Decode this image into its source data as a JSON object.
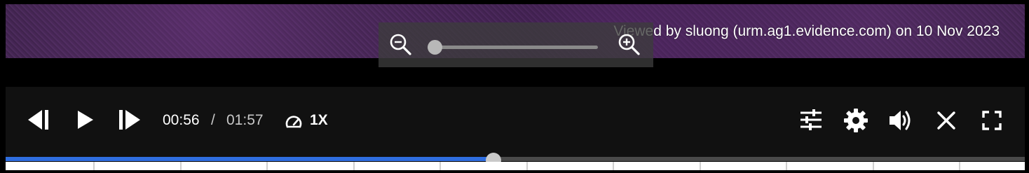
{
  "watermark": {
    "text": "Viewed by sluong (urm.ag1.evidence.com) on 10 Nov 2023"
  },
  "zoom": {
    "level": 0.0,
    "zoom_out_icon": "zoom-out-icon",
    "zoom_in_icon": "zoom-in-icon"
  },
  "player": {
    "current_time": "00:56",
    "separator": "/",
    "duration": "01:57",
    "speed": "1X",
    "progress_fraction": 0.479,
    "icons": {
      "previous_frame": "step-back-icon",
      "play": "play-icon",
      "next_frame": "step-forward-icon",
      "speed": "speedometer-icon",
      "adjust": "sliders-icon",
      "settings": "gear-icon",
      "volume": "volume-icon",
      "close": "close-icon",
      "fullscreen": "fullscreen-icon"
    }
  },
  "colors": {
    "progress_fill": "#2f6ee0",
    "control_bar": "#111111",
    "time_current": "#ffffff",
    "time_muted": "#c8c8c8"
  }
}
